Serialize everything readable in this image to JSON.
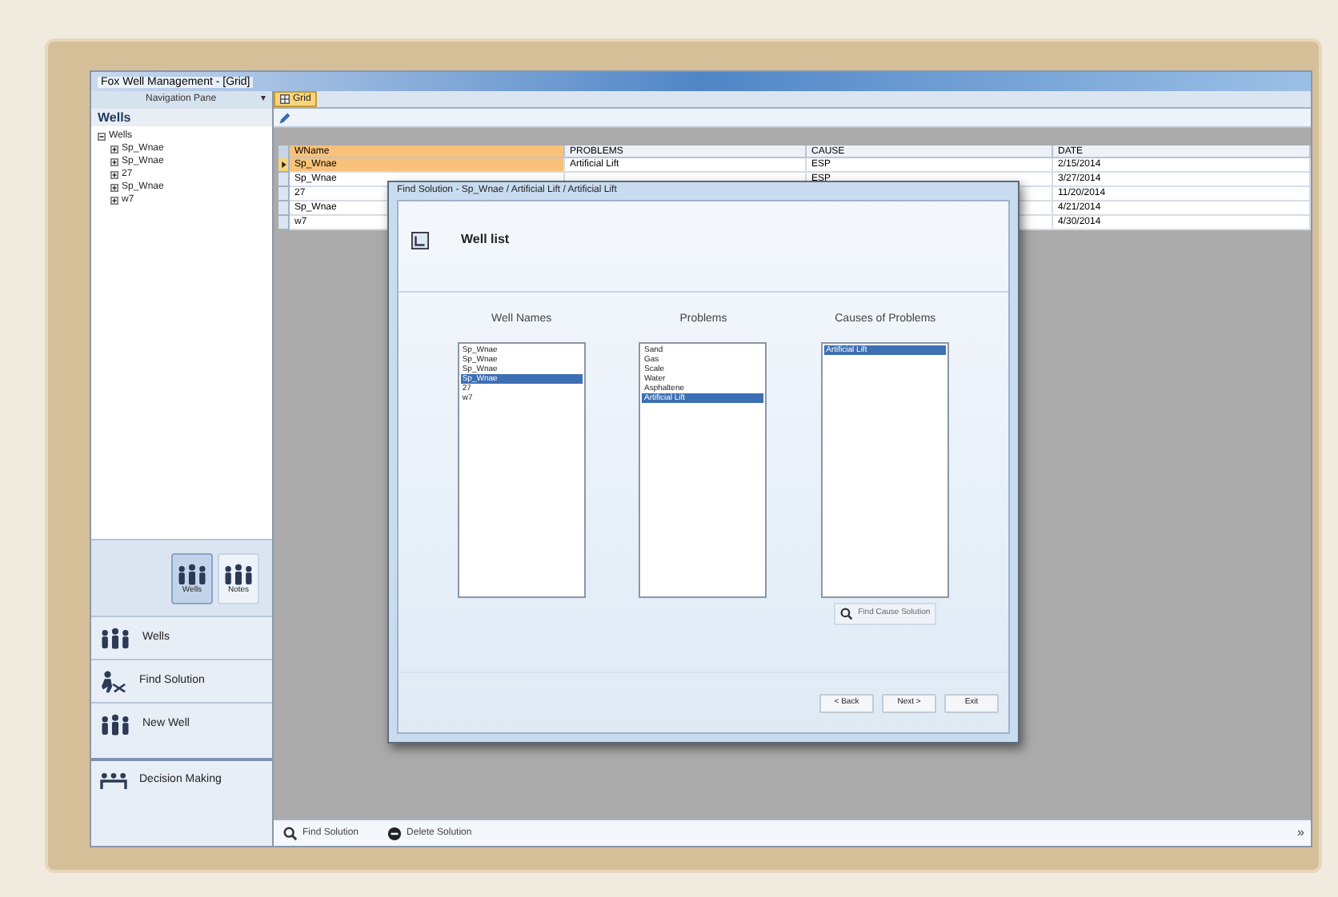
{
  "window": {
    "title": "Fox Well Management - [Grid]"
  },
  "navigation_pane": {
    "title": "Navigation Pane",
    "pin": "▾",
    "header": "Wells",
    "tree": [
      {
        "label": "Wells",
        "expanded": true,
        "children": [
          {
            "label": "Sp_Wnae",
            "expanded": false
          },
          {
            "label": "Sp_Wnae",
            "expanded": false
          },
          {
            "label": "27",
            "expanded": false
          },
          {
            "label": "Sp_Wnae",
            "expanded": false
          },
          {
            "label": "w7",
            "expanded": false
          }
        ]
      }
    ],
    "large_buttons": [
      {
        "label": "Wells",
        "selected": true
      },
      {
        "label": "Notes",
        "selected": false
      }
    ],
    "items": [
      {
        "label": "Wells"
      },
      {
        "label": "Find Solution"
      },
      {
        "label": "New Well"
      },
      {
        "label": "Decision Making"
      }
    ]
  },
  "tab": {
    "label": "Grid"
  },
  "grid": {
    "columns": [
      "WName",
      "PROBLEMS",
      "CAUSE",
      "DATE"
    ],
    "rows": [
      {
        "selected": true,
        "cells": [
          "Sp_Wnae",
          "Artificial Lift",
          "ESP",
          "2/15/2014"
        ]
      },
      {
        "selected": false,
        "cells": [
          "Sp_Wnae",
          "",
          "ESP",
          "3/27/2014"
        ]
      },
      {
        "selected": false,
        "cells": [
          "27",
          "",
          "",
          "11/20/2014"
        ]
      },
      {
        "selected": false,
        "cells": [
          "Sp_Wnae",
          "",
          "",
          "4/21/2014"
        ]
      },
      {
        "selected": false,
        "cells": [
          "w7",
          "",
          "",
          "4/30/2014"
        ]
      }
    ]
  },
  "dialog": {
    "title": "Find Solution - Sp_Wnae / Artificial Lift / Artificial Lift",
    "heading": "Well list",
    "lists": [
      {
        "title": "Well Names",
        "items": [
          {
            "label": "Sp_Wnae",
            "selected": false
          },
          {
            "label": "Sp_Wnae",
            "selected": false
          },
          {
            "label": "Sp_Wnae",
            "selected": false
          },
          {
            "label": "Sp_Wnae",
            "selected": true
          },
          {
            "label": "27",
            "selected": false
          },
          {
            "label": "w7",
            "selected": false
          }
        ]
      },
      {
        "title": "Problems",
        "items": [
          {
            "label": "Sand",
            "selected": false
          },
          {
            "label": "Gas",
            "selected": false
          },
          {
            "label": "Scale",
            "selected": false
          },
          {
            "label": "Water",
            "selected": false
          },
          {
            "label": "Asphaltene",
            "selected": false
          },
          {
            "label": "Artificial Lift",
            "selected": true
          }
        ]
      },
      {
        "title": "Causes of Problems",
        "items": [
          {
            "label": "Artificial Lift",
            "selected": true
          }
        ]
      }
    ],
    "find_button": "Find Cause Solution",
    "buttons": [
      "< Back",
      "Next >",
      "Exit"
    ]
  },
  "bottom_bar": {
    "buttons": [
      {
        "kind": "find",
        "label": "Find Solution"
      },
      {
        "kind": "delete",
        "label": "Delete Solution"
      }
    ],
    "overflow": "»"
  }
}
